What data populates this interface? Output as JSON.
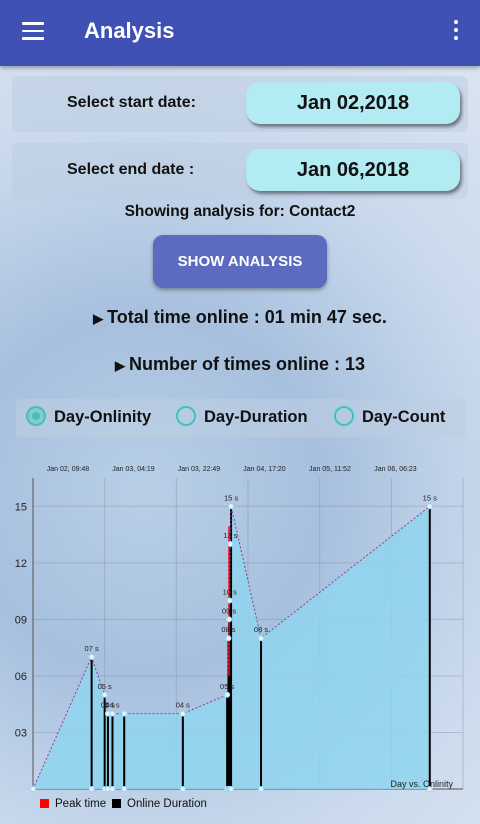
{
  "appbar": {
    "title": "Analysis",
    "menu_icon": "menu-icon",
    "overflow_icon": "more-vert-icon",
    "color": "#3f51b5"
  },
  "start": {
    "label": "Select start date:",
    "value": "Jan 02,2018"
  },
  "end": {
    "label": "Select end date :",
    "value": "Jan 06,2018"
  },
  "showing": "Showing analysis for: Contact2",
  "show_button": "SHOW ANALYSIS",
  "stats": {
    "total": "Total time online : 01 min 47 sec.",
    "count": "Number of times online : 13"
  },
  "radios": [
    {
      "label": "Day-Onlinity",
      "checked": true
    },
    {
      "label": "Day-Duration",
      "checked": false
    },
    {
      "label": "Day-Count",
      "checked": false
    }
  ],
  "legend": {
    "peak": "Peak time",
    "duration": "Online Duration",
    "peak_color": "#ff0000",
    "duration_color": "#000000"
  },
  "chart_data": {
    "type": "area",
    "description": "Day vs. Onlinity",
    "top_labels": [
      "Jan 02, 09:48",
      "Jan 03, 04:19",
      "Jan 03, 22:49",
      "Jan 04, 17:20",
      "Jan 05, 11:52",
      "Jan 06, 06:23"
    ],
    "y_ticks": [
      "03",
      "06",
      "09",
      "12",
      "15"
    ],
    "ylim": [
      0,
      16.5
    ],
    "points": [
      {
        "t": 0.0,
        "v": 0,
        "label": ""
      },
      {
        "t": 0.9,
        "v": 7,
        "label": "07 s"
      },
      {
        "t": 1.1,
        "v": 5,
        "label": "05 s"
      },
      {
        "t": 1.15,
        "v": 4,
        "label": "04 s"
      },
      {
        "t": 1.22,
        "v": 4,
        "label": "04 s"
      },
      {
        "t": 1.4,
        "v": 4,
        "label": ""
      },
      {
        "t": 2.3,
        "v": 4,
        "label": "04 s"
      },
      {
        "t": 2.98,
        "v": 5,
        "label": "05 s"
      },
      {
        "t": 3.0,
        "v": 8,
        "label": "08 s"
      },
      {
        "t": 3.01,
        "v": 9,
        "label": "09 s"
      },
      {
        "t": 3.02,
        "v": 10,
        "label": "10 s"
      },
      {
        "t": 3.03,
        "v": 13,
        "label": "13 s"
      },
      {
        "t": 3.04,
        "v": 15,
        "label": "15 s"
      },
      {
        "t": 3.5,
        "v": 8,
        "label": "08 s"
      },
      {
        "t": 6.09,
        "v": 15,
        "label": "15 s"
      }
    ],
    "area_color": "#8fd3ee",
    "line_color": "#8e3f87"
  }
}
